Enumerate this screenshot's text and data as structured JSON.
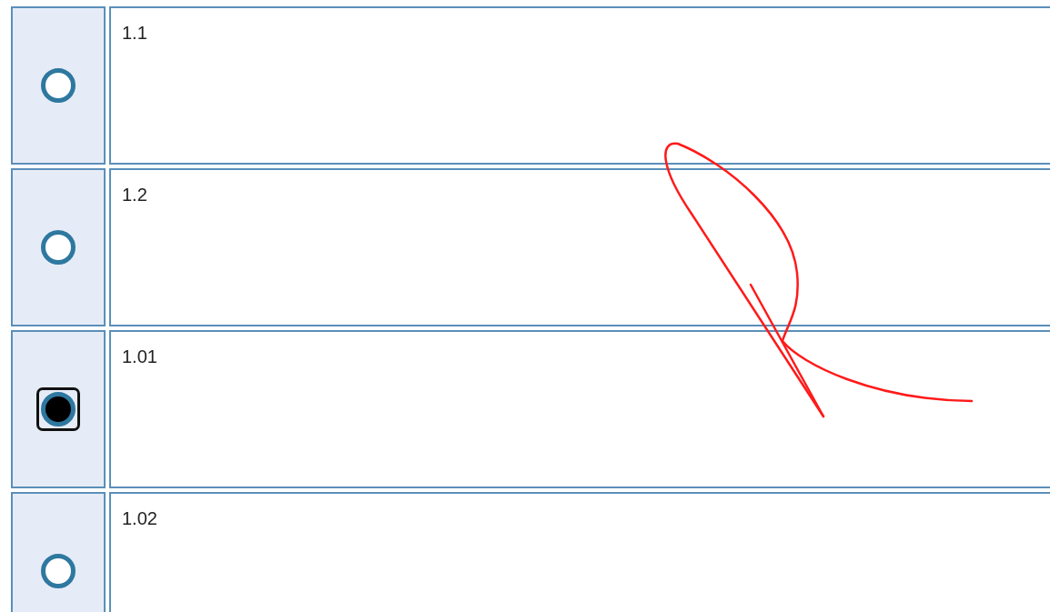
{
  "options": [
    {
      "label": "1.1",
      "selected": false
    },
    {
      "label": "1.2",
      "selected": false
    },
    {
      "label": "1.01",
      "selected": true
    },
    {
      "label": "1.02",
      "selected": false
    }
  ]
}
